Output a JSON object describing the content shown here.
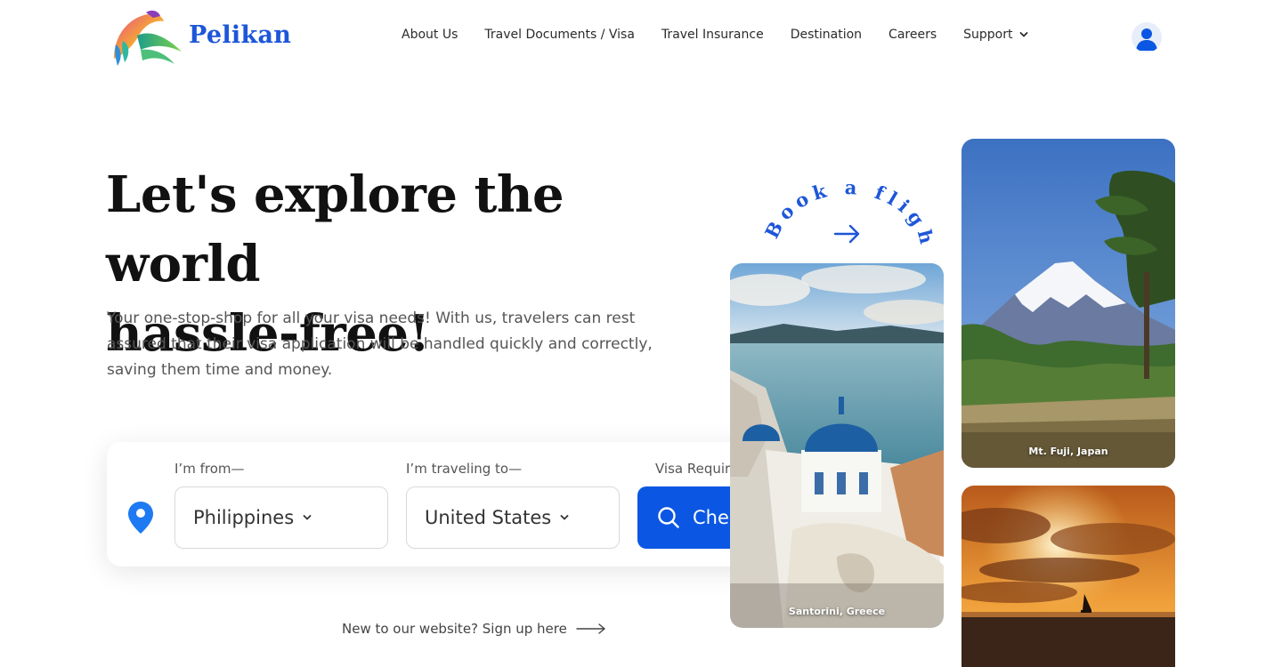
{
  "brand": {
    "name": "Pelikan",
    "accent": "#1d56d8",
    "button_color": "#0b57e3"
  },
  "nav": {
    "items": [
      {
        "label": "About Us"
      },
      {
        "label": "Travel Documents / Visa"
      },
      {
        "label": "Travel Insurance"
      },
      {
        "label": "Destination"
      },
      {
        "label": "Careers"
      },
      {
        "label": "Support",
        "has_dropdown": true
      }
    ],
    "profile_icon": "user-avatar-icon"
  },
  "hero": {
    "title_line1": "Let's explore the world",
    "title_line2": "hassle-free!",
    "subtitle": "Your one-stop-shop for all your visa needs! With us, travelers can rest assured that their visa application will be handled quickly and correctly, saving them time and money."
  },
  "search": {
    "from_label": "I’m from—",
    "from_value": "Philippines",
    "to_label": "I’m traveling to—",
    "to_value": "United States",
    "visa_label": "Visa Requirements",
    "button_label": "Check Now",
    "location_icon": "map-pin-icon"
  },
  "signup": {
    "text": "New to our website? Sign up here"
  },
  "book_flight": {
    "text": "Book a flight"
  },
  "destinations": [
    {
      "caption": "Santorini, Greece"
    },
    {
      "caption": "Mt. Fuji, Japan"
    },
    {
      "caption": ""
    }
  ]
}
